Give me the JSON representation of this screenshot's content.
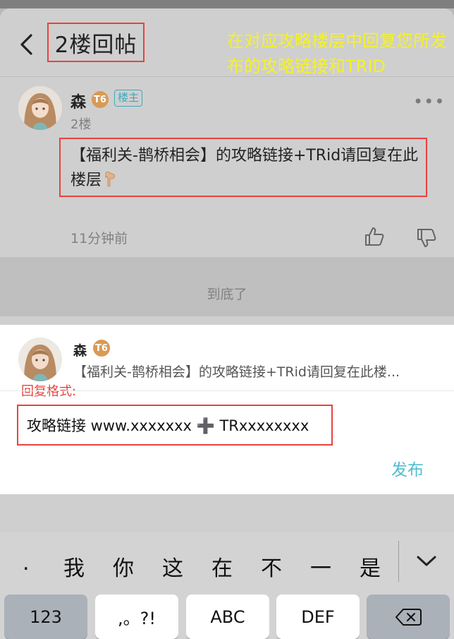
{
  "header": {
    "title": "2楼回帖",
    "annotation": "在对应攻略楼层中回复您所发布的攻略链接和TRID"
  },
  "post": {
    "username": "森",
    "level": "T6",
    "owner_tag": "楼主",
    "floor": "2楼",
    "content": "【福利关-鹊桥相会】的攻略链接+TRid请回复在此楼层",
    "time": "11分钟前",
    "more": "•••"
  },
  "end_text": "到底了",
  "reply": {
    "username": "森",
    "level": "T6",
    "quote": "【福利关-鹊桥相会】的攻略链接+TRid请回复在此楼...",
    "format_note": "回复格式:",
    "input_value": "攻略链接 www.xxxxxxx ➕ TRxxxxxxxx",
    "publish_label": "发布"
  },
  "keyboard": {
    "candidates": [
      ".",
      "我",
      "你",
      "这",
      "在",
      "不",
      "一",
      "是"
    ],
    "keys": [
      "123",
      ",。?!",
      "ABC",
      "DEF"
    ]
  },
  "icons": {
    "back": "chevron-left-icon",
    "like": "thumbs-up-icon",
    "dislike": "thumbs-down-icon",
    "collapse": "chevron-down-icon",
    "delete": "backspace-icon"
  },
  "colors": {
    "accent": "#52bcd0",
    "annotation_red": "#e8423f",
    "annotation_yellow": "#f4f12a",
    "level_badge": "#d99a56"
  }
}
